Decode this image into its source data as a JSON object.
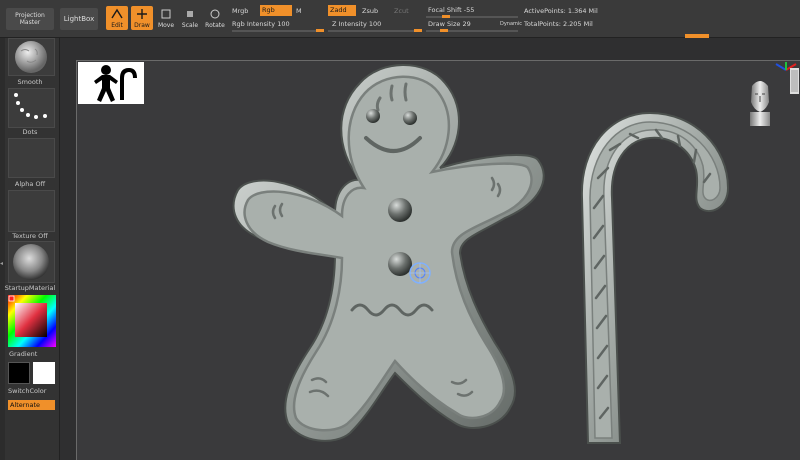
{
  "toolbar": {
    "projection_master": "Projection Master",
    "lightbox": "LightBox",
    "edit": "Edit",
    "draw": "Draw",
    "move": "Move",
    "scale": "Scale",
    "rotate": "Rotate",
    "mrgb": "Mrgb",
    "rgb": "Rgb",
    "m": "M",
    "rgb_intensity_label": "Rgb Intensity",
    "rgb_intensity_value": "100",
    "zadd": "Zadd",
    "zsub": "Zsub",
    "zcut": "Zcut",
    "z_intensity_label": "Z Intensity",
    "z_intensity_value": "100",
    "focal_shift_label": "Focal Shift",
    "focal_shift_value": "-55",
    "draw_size_label": "Draw Size",
    "draw_size_value": "29",
    "dynamic": "Dynamic",
    "active_points": "ActivePoints: 1.364 Mil",
    "total_points": "TotalPoints: 2.205 Mil"
  },
  "shelf": {
    "brush_label": "Smooth",
    "stroke_label": "Dots",
    "alpha_label": "Alpha Off",
    "texture_label": "Texture Off",
    "material_label": "StartupMaterial",
    "gradient_label": "Gradient",
    "switch_label": "SwitchColor",
    "alternate_label": "Alternate"
  },
  "colors": {
    "accent": "#f0902a",
    "cookie": "#a8b0ab",
    "background": "#3a3a3c"
  },
  "icons": {
    "gizmo": "navigation-axis-icon",
    "head": "head-preview-icon",
    "cursor": "brush-cursor-icon"
  }
}
